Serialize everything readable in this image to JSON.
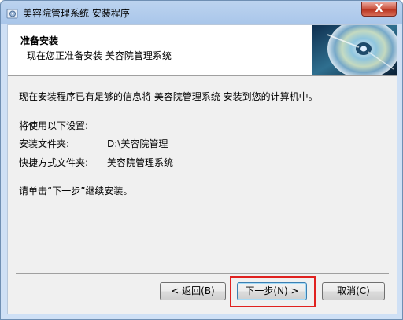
{
  "window": {
    "title": "美容院管理系统 安装程序",
    "close_label": "X"
  },
  "header": {
    "title": "准备安装",
    "subtitle": "现在您正准备安装 美容院管理系统"
  },
  "body": {
    "intro": "现在安装程序已有足够的信息将 美容院管理系统 安装到您的计算机中。",
    "settings_label": "将使用以下设置:",
    "install_folder_label": "安装文件夹:",
    "install_folder_value": "D:\\美容院管理",
    "shortcut_folder_label": "快捷方式文件夹:",
    "shortcut_folder_value": "美容院管理系统",
    "continue_hint": "请单击“下一步”继续安装。"
  },
  "buttons": {
    "back": "< 返回(B)",
    "next": "下一步(N) >",
    "cancel": "取消(C)"
  },
  "colors": {
    "highlight": "#e0211f",
    "titlebar": "#bcd3ef"
  },
  "icons": {
    "app": "installer-icon",
    "header_image": "cd-disc-icon"
  }
}
